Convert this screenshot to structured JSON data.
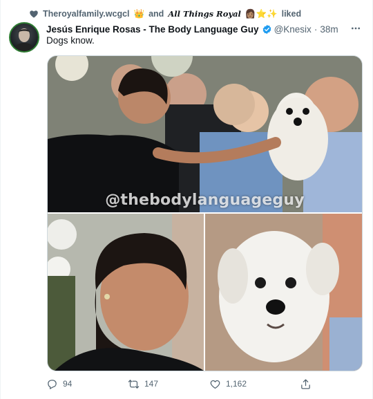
{
  "liked_by": {
    "account": "Theroyalfamily.wcgcl",
    "connector": "and",
    "other_account": "𝑨𝒍𝒍 𝑻𝒉𝒊𝒏𝒈𝒔 𝑹𝒐𝒚𝒂𝒍",
    "emoji_a": "👑",
    "emoji_b": "👩🏽⭐✨",
    "action": "liked"
  },
  "tweet": {
    "author_name": "Jesús Enrique Rosas - The Body Language Guy",
    "handle": "@Knesix",
    "separator": "·",
    "time": "38m",
    "text": "Dogs know.",
    "watermark": "@thebodylanguageguy",
    "images": [
      {
        "alt": "Woman in black reaching toward a small white dog held by a smiling woman in a crowd"
      },
      {
        "alt": "Close-up of woman in black looking toward the dog"
      },
      {
        "alt": "Close-up of small white fluffy dog"
      }
    ]
  },
  "actions": {
    "reply_count": "94",
    "retweet_count": "147",
    "like_count": "1,162"
  },
  "colors": {
    "text_primary": "#0f1419",
    "text_secondary": "#536471",
    "verified_blue": "#1d9bf0",
    "border": "#cfd9de",
    "avatar_ring": "#2e7d32"
  }
}
